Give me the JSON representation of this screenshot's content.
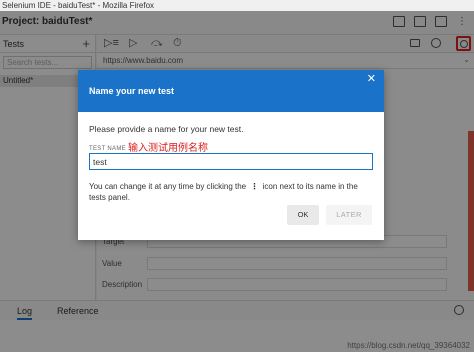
{
  "window": {
    "title": "Selenium IDE - baiduTest* - Mozilla Firefox"
  },
  "project": {
    "label": "Project: baiduTest*",
    "more_glyph": "⋮"
  },
  "sidebar": {
    "header_label": "Tests",
    "add_glyph": "+",
    "search_placeholder": "Search tests...",
    "items": [
      {
        "label": "Untitled*"
      }
    ]
  },
  "toolbar": {
    "run_all_glyph": "▷≡",
    "run_glyph": "▷",
    "disable_glyph": "⤼",
    "speed_glyph": "⏱"
  },
  "url_bar": {
    "value": "https://www.baidu.com",
    "chevron": "⌄"
  },
  "editor": {
    "fields": [
      {
        "label": "Target"
      },
      {
        "label": "Value"
      },
      {
        "label": "Description"
      }
    ]
  },
  "bottom_tabs": [
    {
      "label": "Log"
    },
    {
      "label": "Reference"
    }
  ],
  "watermark": "https://blog.csdn.net/qq_39364032",
  "dialog": {
    "title": "Name your new test",
    "close_glyph": "✕",
    "prompt": "Please provide a name for your new test.",
    "field_label": "TEST NAME",
    "annotation": "输入测试用例名称",
    "input_value": "test",
    "help_before": "You can change it at any time by clicking the",
    "help_dots": "⋮",
    "help_after": "icon next to its name in the tests panel.",
    "ok_label": "OK",
    "later_label": "LATER"
  },
  "colors": {
    "accent": "#1a73c9",
    "annotation": "#e02020"
  }
}
